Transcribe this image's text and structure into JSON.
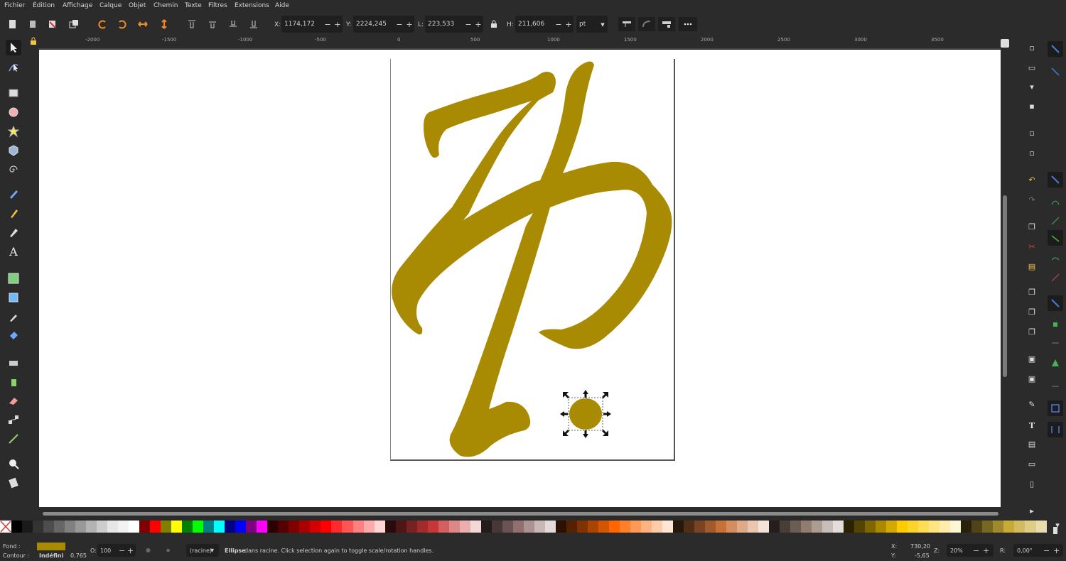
{
  "menu": [
    "Fichier",
    "Édition",
    "Affichage",
    "Calque",
    "Objet",
    "Chemin",
    "Texte",
    "Filtres",
    "Extensions",
    "Aide"
  ],
  "tool_controls": {
    "x_label": "X:",
    "x_value": "1174,172",
    "y_label": "Y:",
    "y_value": "2224,245",
    "w_label": "L:",
    "w_value": "223,533",
    "h_label": "H:",
    "h_value": "211,606",
    "unit": "pt"
  },
  "ruler_ticks": [
    "-2000",
    "-1500",
    "-1000",
    "-500",
    "0",
    "500",
    "1000",
    "1500",
    "2000",
    "2500",
    "3000",
    "3500"
  ],
  "fill_color": "#a98b03",
  "status": {
    "fill_label": "Fond :",
    "stroke_label": "Contour :",
    "stroke_value": "Indéfini",
    "stroke_width": "0,765",
    "opacity_label": "O:",
    "opacity_value": "100",
    "layer": "(racine)",
    "message_bold": "Ellipse",
    "message": " dans racine. Click selection again to toggle scale/rotation handles.",
    "cursor_x_label": "X:",
    "cursor_x": "730,20",
    "cursor_y_label": "Y:",
    "cursor_y": "-5,65",
    "zoom_label": "Z:",
    "zoom": "20%",
    "rotation_label": "R:",
    "rotation": "0,00°"
  },
  "palette": [
    "#000000",
    "#1a1a1a",
    "#333333",
    "#4d4d4d",
    "#666666",
    "#808080",
    "#999999",
    "#b3b3b3",
    "#cccccc",
    "#e6e6e6",
    "#f2f2f2",
    "#ffffff",
    "#800000",
    "#ff0000",
    "#808000",
    "#ffff00",
    "#008000",
    "#00ff00",
    "#008080",
    "#00ffff",
    "#000080",
    "#0000ff",
    "#800080",
    "#ff00ff",
    "#2b0000",
    "#550000",
    "#800000",
    "#aa0000",
    "#d40000",
    "#ff0000",
    "#ff2a2a",
    "#ff5555",
    "#ff8080",
    "#ffaaaa",
    "#ffd5d5",
    "#280b0b",
    "#501616",
    "#782121",
    "#a02c2c",
    "#c83737",
    "#d35f5f",
    "#de8787",
    "#e9afaf",
    "#f4d7d7",
    "#241c1c",
    "#483737",
    "#6c5353",
    "#916f6f",
    "#ac9393",
    "#c8b7b7",
    "#e3dbdb",
    "#2b1100",
    "#552200",
    "#803300",
    "#aa4400",
    "#d45500",
    "#ff6600",
    "#ff7f2a",
    "#ff9955",
    "#ffb380",
    "#ffccaa",
    "#ffe6d5",
    "#28170b",
    "#502d16",
    "#784421",
    "#a05a2c",
    "#c87137",
    "#d38d5f",
    "#deaa87",
    "#e9c6af",
    "#f4e3d7",
    "#241f1c",
    "#483e37",
    "#6c5d53",
    "#917c6f",
    "#ac9d93",
    "#c8beb7",
    "#e3dedb",
    "#2b2200",
    "#554400",
    "#806600",
    "#aa8800",
    "#d4aa00",
    "#ffcc00",
    "#ffd42a",
    "#ffdd55",
    "#ffe680",
    "#ffeeaa",
    "#fff6d5",
    "#28220b",
    "#504416",
    "#786721",
    "#a0892c",
    "#c8ab37",
    "#d3bc5f",
    "#decd87",
    "#e9ddaf"
  ]
}
